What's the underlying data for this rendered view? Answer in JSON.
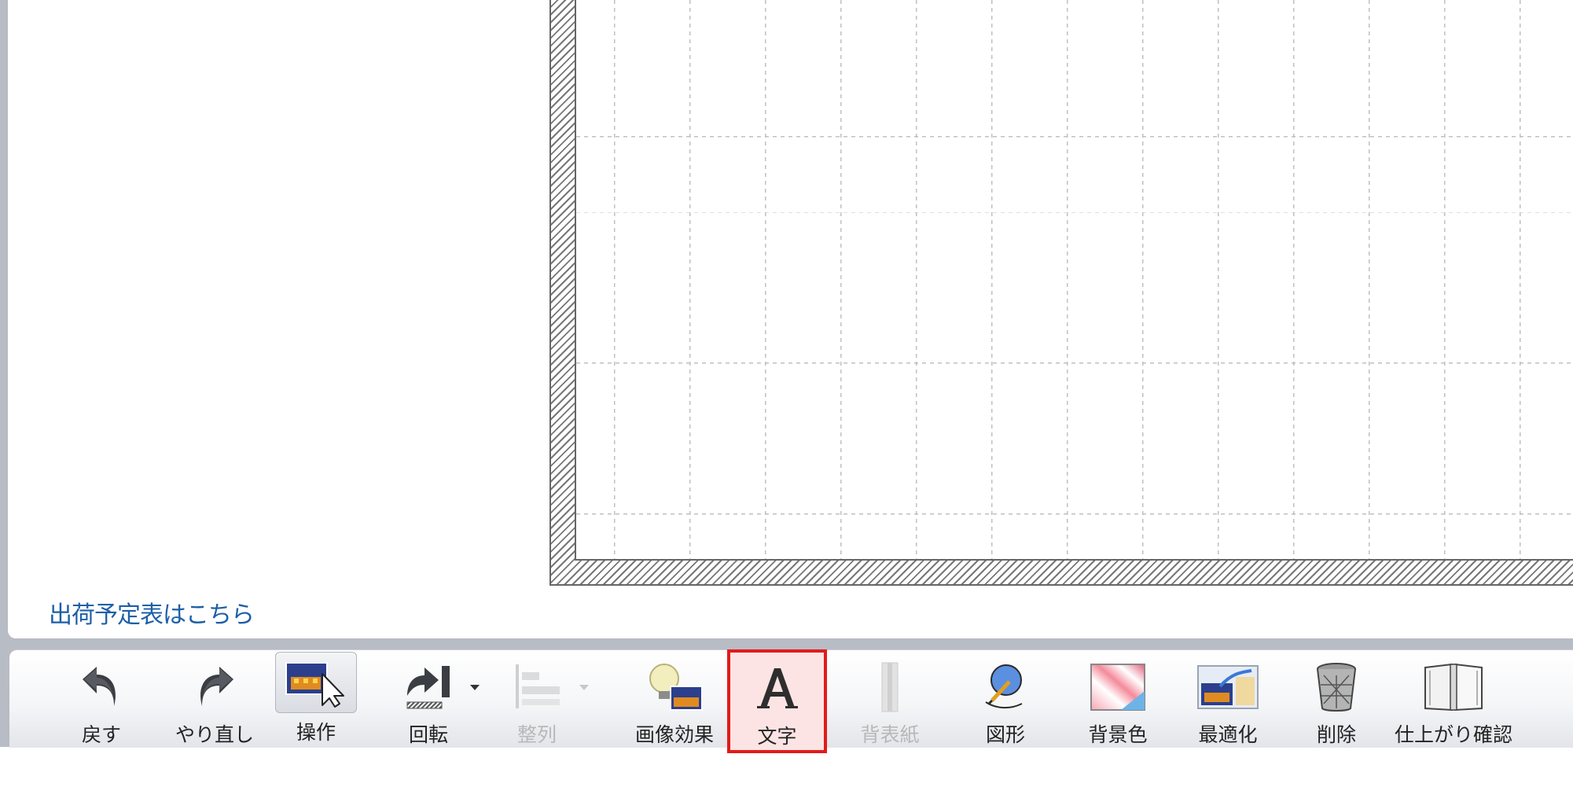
{
  "link_text": "出荷予定表はこちら",
  "colors": {
    "highlight_border": "#e11b1b",
    "link": "#1d5fa8",
    "frame": "#b8bcc4"
  },
  "toolbar": {
    "items": [
      {
        "key": "undo",
        "label": "戻す",
        "icon": "undo-arrow-icon",
        "state": "normal"
      },
      {
        "key": "redo",
        "label": "やり直し",
        "icon": "redo-arrow-icon",
        "state": "normal"
      },
      {
        "key": "operate",
        "label": "操作",
        "icon": "select-cursor-icon",
        "state": "pressed"
      },
      {
        "key": "rotate",
        "label": "回転",
        "icon": "rotate-icon",
        "state": "normal",
        "has_dropdown": true
      },
      {
        "key": "align",
        "label": "整列",
        "icon": "align-icon",
        "state": "disabled",
        "has_dropdown": true
      },
      {
        "key": "effect",
        "label": "画像効果",
        "icon": "image-effect-icon",
        "state": "normal"
      },
      {
        "key": "text",
        "label": "文字",
        "icon": "text-a-icon",
        "state": "highlighted"
      },
      {
        "key": "endpaper",
        "label": "背表紙",
        "icon": "spine-icon",
        "state": "disabled"
      },
      {
        "key": "shape",
        "label": "図形",
        "icon": "shape-icon",
        "state": "normal"
      },
      {
        "key": "bgcolor",
        "label": "背景色",
        "icon": "background-color-icon",
        "state": "normal"
      },
      {
        "key": "optimize",
        "label": "最適化",
        "icon": "optimize-icon",
        "state": "normal"
      },
      {
        "key": "delete",
        "label": "削除",
        "icon": "trash-icon",
        "state": "normal"
      },
      {
        "key": "preview",
        "label": "仕上がり確認",
        "icon": "book-preview-icon",
        "state": "normal"
      }
    ]
  }
}
